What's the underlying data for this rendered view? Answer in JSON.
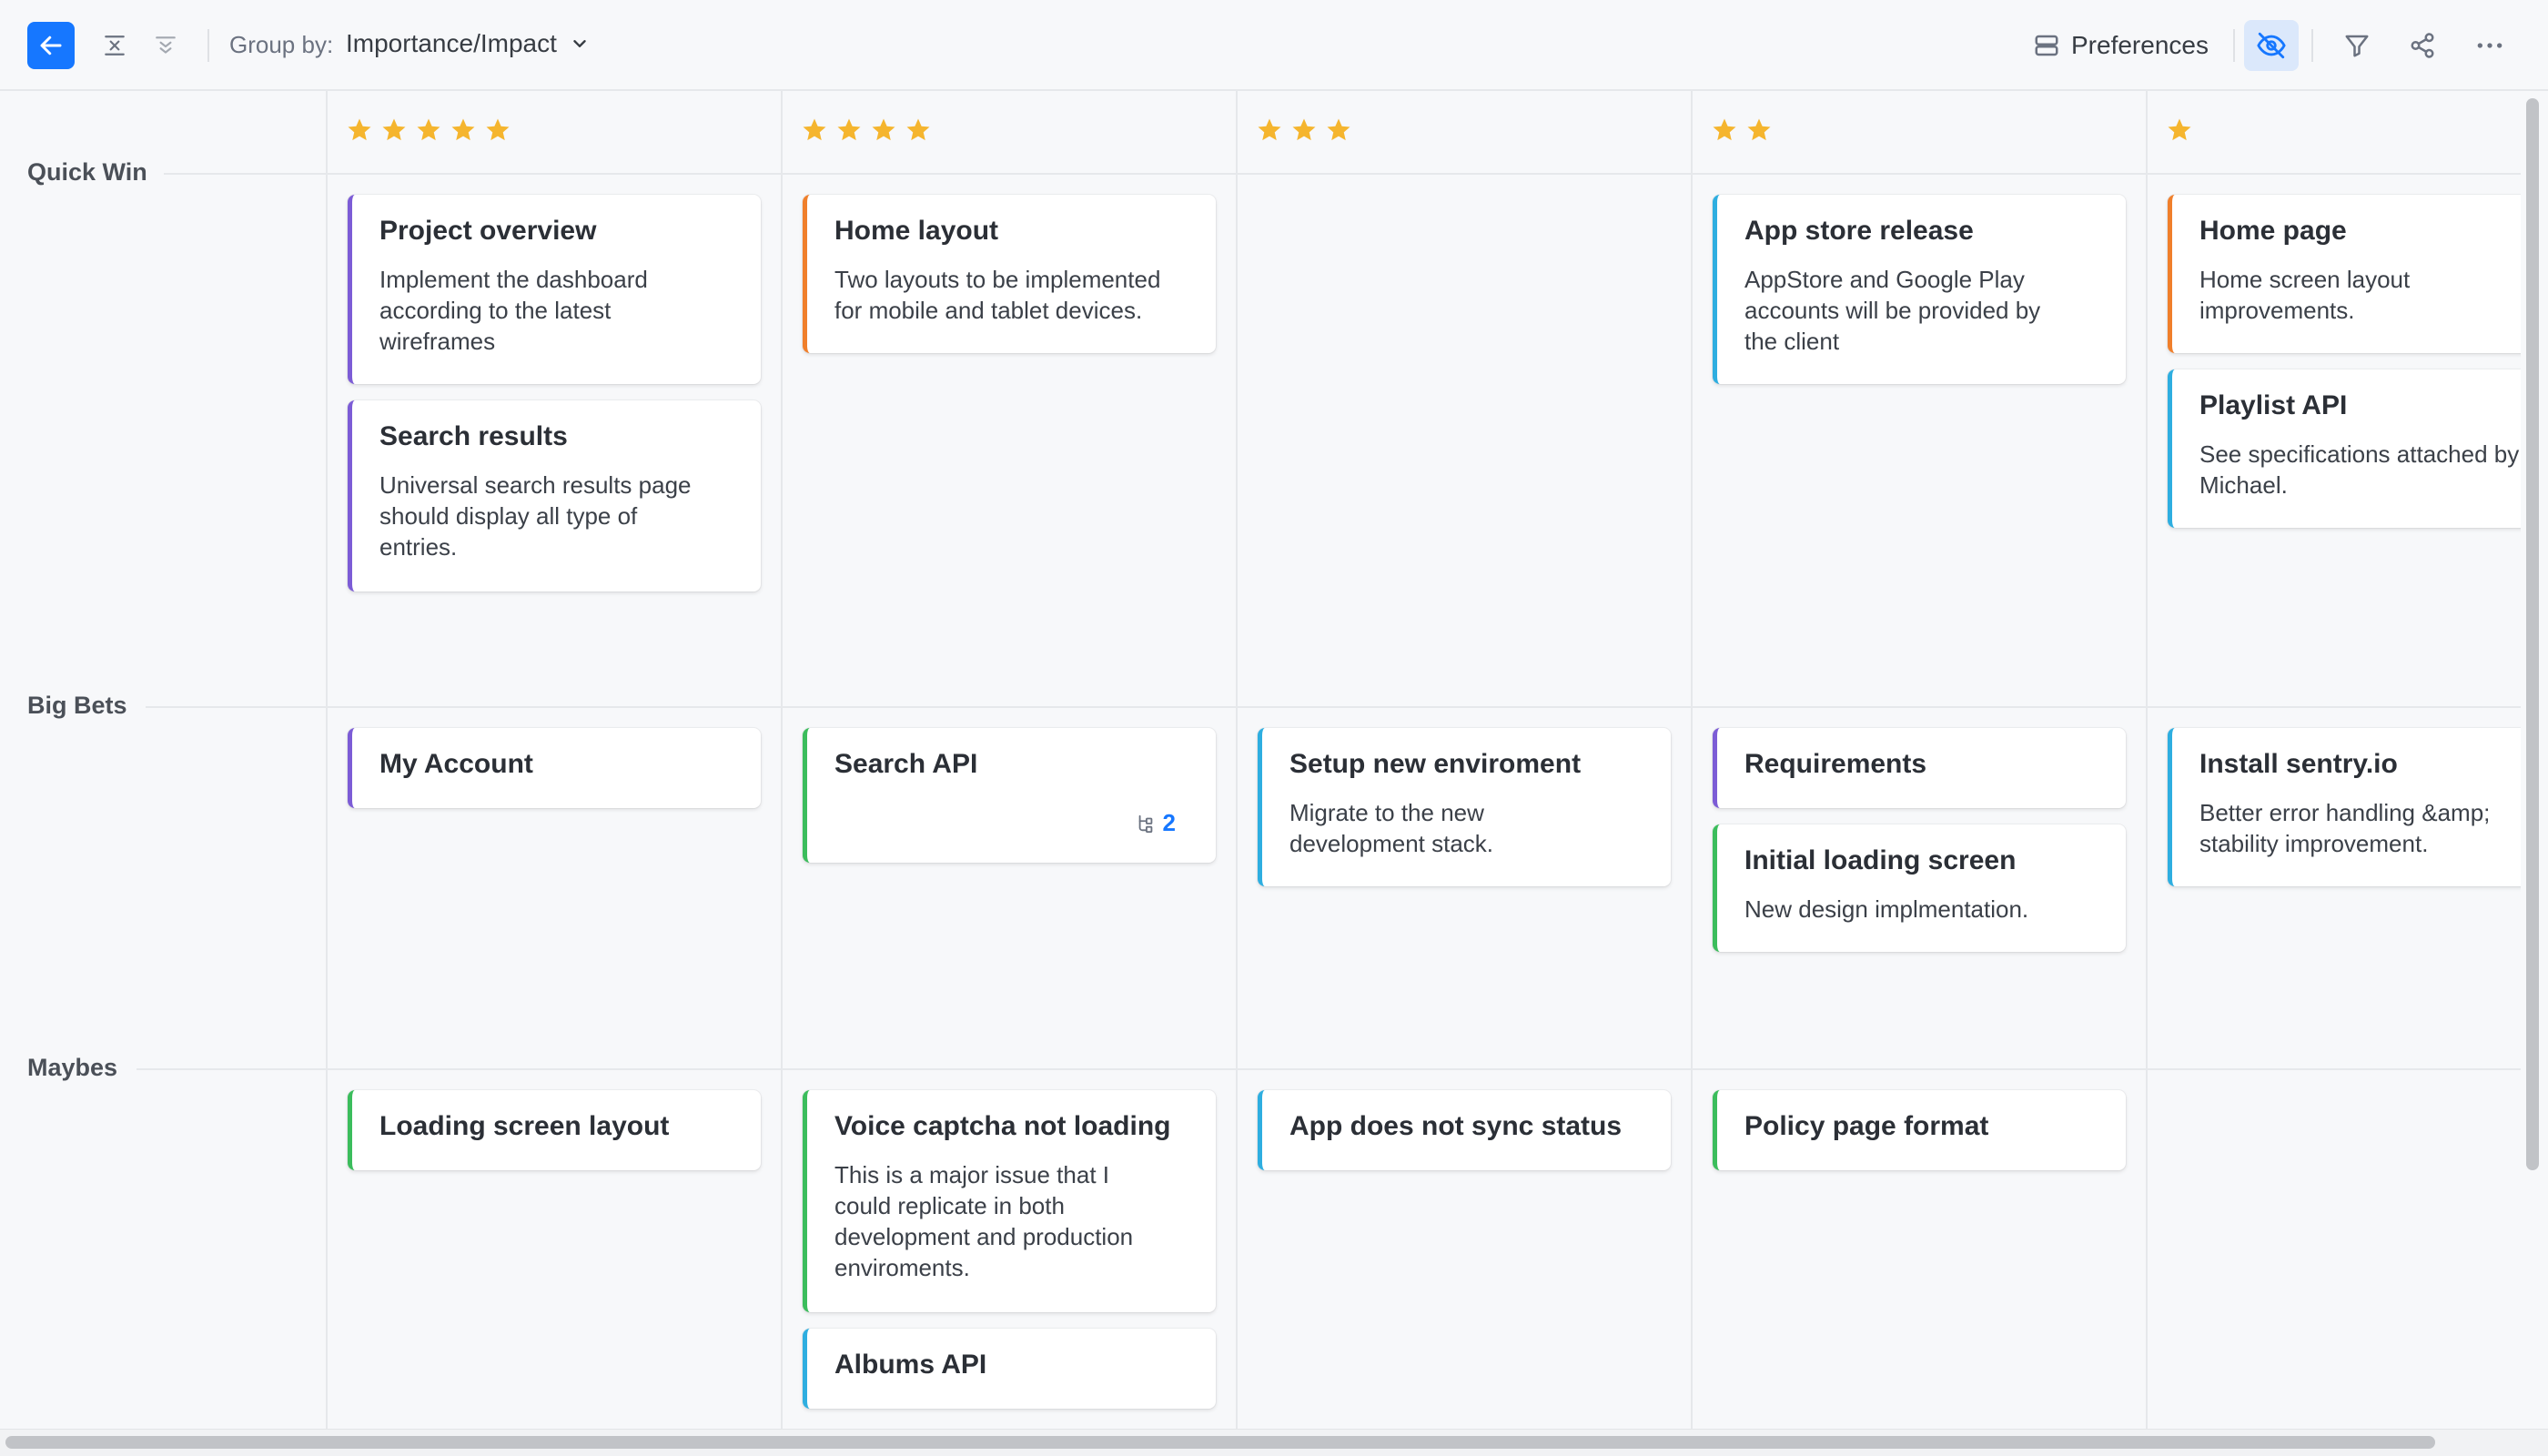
{
  "toolbar": {
    "group_by_label": "Group by:",
    "group_by_value": "Importance/Impact",
    "preferences_label": "Preferences",
    "accent": "#1677ff"
  },
  "star_color": "#f5b52e",
  "columns": [
    {
      "stars": 5
    },
    {
      "stars": 4
    },
    {
      "stars": 3
    },
    {
      "stars": 2
    },
    {
      "stars": 1
    }
  ],
  "rows": [
    {
      "label": "Quick Win"
    },
    {
      "label": "Big Bets"
    },
    {
      "label": "Maybes"
    }
  ],
  "cards": [
    {
      "title": "Project overview",
      "desc": "Implement the dashboard\naccording to the latest\nwireframes",
      "color": "#7c5cd6"
    },
    {
      "title": "Search results",
      "desc": "Universal search results page\nshould display all type of\nentries.",
      "color": "#7c5cd6"
    },
    {
      "title": "Home layout",
      "desc": "Two layouts to be implemented\nfor mobile and tablet devices.",
      "color": "#f07f2b"
    },
    {
      "title": "App store release",
      "desc": "AppStore and Google Play\naccounts will be provided by\nthe client",
      "color": "#2eaee0"
    },
    {
      "title": "Home page",
      "desc": "Home screen layout\nimprovements.",
      "color": "#f07f2b"
    },
    {
      "title": "Playlist API",
      "desc": "See specifications attached by\nMichael.",
      "color": "#2eaee0"
    },
    {
      "title": "My Account",
      "desc": "",
      "color": "#7c5cd6"
    },
    {
      "title": "Search API",
      "desc": "",
      "color": "#3bbd5c",
      "subtasks": "2"
    },
    {
      "title": "Setup new enviroment",
      "desc": "Migrate to the new\ndevelopment stack.",
      "color": "#2eaee0"
    },
    {
      "title": "Requirements",
      "desc": "",
      "color": "#7c5cd6"
    },
    {
      "title": "Initial loading screen",
      "desc": "New design implmentation.",
      "color": "#3bbd5c"
    },
    {
      "title": "Install sentry.io",
      "desc": "Better error handling &amp;\nstability improvement.",
      "color": "#2eaee0"
    },
    {
      "title": "Loading screen layout",
      "desc": "",
      "color": "#3bbd5c"
    },
    {
      "title": "Voice captcha not loading",
      "desc": "This is a major issue that I\ncould replicate in both\ndevelopment and production\nenviroments.",
      "color": "#3bbd5c"
    },
    {
      "title": "Albums API",
      "desc": "",
      "color": "#2eaee0"
    },
    {
      "title": "App does not sync status",
      "desc": "",
      "color": "#2eaee0"
    },
    {
      "title": "Policy page format",
      "desc": "",
      "color": "#3bbd5c"
    }
  ]
}
